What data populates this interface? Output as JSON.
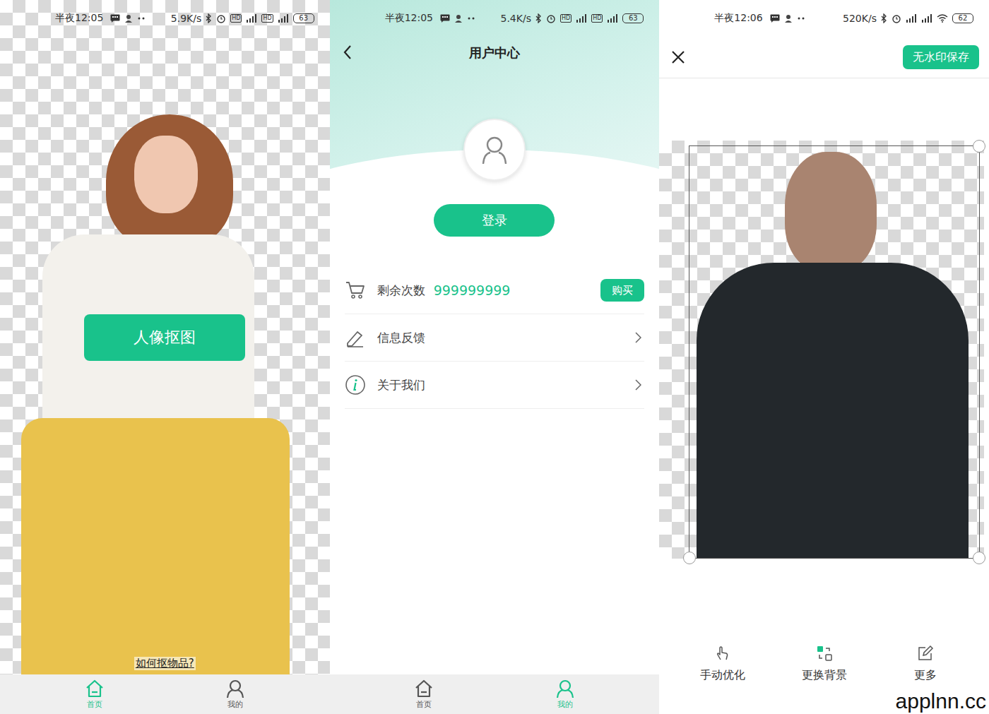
{
  "home": {
    "status_bar": {
      "time": "半夜12:05",
      "speed": "5.9K/s",
      "badges": [
        "HD",
        "HD"
      ],
      "battery": "63"
    },
    "action_button": "人像抠图",
    "link": "如何抠物品?",
    "nav": [
      {
        "label": "首页",
        "selected": true
      },
      {
        "label": "我的",
        "selected": false
      }
    ]
  },
  "user_center": {
    "status_bar": {
      "time": "半夜12:05",
      "speed": "5.4K/s",
      "badges": [
        "HD",
        "HD"
      ],
      "battery": "63"
    },
    "title": "用户中心",
    "login_button": "登录",
    "rows": [
      {
        "kind": "count",
        "label": "剩余次数",
        "value": "999999999",
        "action": "购买"
      },
      {
        "kind": "link",
        "label": "信息反馈"
      },
      {
        "kind": "link",
        "label": "关于我们"
      }
    ],
    "nav": [
      {
        "label": "首页",
        "selected": false
      },
      {
        "label": "我的",
        "selected": true
      }
    ]
  },
  "editor": {
    "status_bar": {
      "time": "半夜12:06",
      "speed": "520K/s",
      "badges": [],
      "battery": "62"
    },
    "save_button": "无水印保存",
    "tools": [
      {
        "label": "手动优化"
      },
      {
        "label": "更换背景"
      },
      {
        "label": "更多"
      }
    ]
  },
  "watermark": "applnn.cc"
}
